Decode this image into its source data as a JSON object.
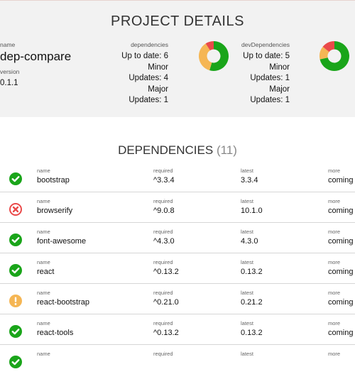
{
  "project_details": {
    "title": "PROJECT DETAILS",
    "name_label": "name",
    "name": "dep-compare",
    "version_label": "version",
    "version": "0.1.1",
    "dependencies": {
      "label": "dependencies",
      "lines": [
        "Up to date: 6",
        "Minor",
        "Updates: 4",
        "Major",
        "Updates: 1"
      ],
      "up_to_date": 6,
      "minor_updates": 4,
      "major_updates": 1
    },
    "devDependencies": {
      "label": "devDependencies",
      "lines": [
        "Up to date: 5",
        "Minor",
        "Updates: 1",
        "Major",
        "Updates: 1"
      ],
      "up_to_date": 5,
      "minor_updates": 1,
      "major_updates": 1
    }
  },
  "colors": {
    "up_to_date": "#1aa51a",
    "minor": "#f5b654",
    "major": "#ea4a4a",
    "details_bg": "#f2f2f2",
    "separator": "#d6d6d6"
  },
  "dependencies": {
    "title": "DEPENDENCIES",
    "count": "(11)",
    "columns": {
      "name": "name",
      "required": "required",
      "latest": "latest",
      "more": "more"
    },
    "rows": [
      {
        "status": "ok",
        "status_icon": "check-circle-icon",
        "name": "bootstrap",
        "required": "^3.3.4",
        "latest": "3.3.4",
        "more": "coming"
      },
      {
        "status": "major",
        "status_icon": "x-circle-icon",
        "name": "browserify",
        "required": "^9.0.8",
        "latest": "10.1.0",
        "more": "coming"
      },
      {
        "status": "ok",
        "status_icon": "check-circle-icon",
        "name": "font-awesome",
        "required": "^4.3.0",
        "latest": "4.3.0",
        "more": "coming"
      },
      {
        "status": "ok",
        "status_icon": "check-circle-icon",
        "name": "react",
        "required": "^0.13.2",
        "latest": "0.13.2",
        "more": "coming"
      },
      {
        "status": "minor",
        "status_icon": "exclamation-circle-icon",
        "name": "react-bootstrap",
        "required": "^0.21.0",
        "latest": "0.21.2",
        "more": "coming"
      },
      {
        "status": "ok",
        "status_icon": "check-circle-icon",
        "name": "react-tools",
        "required": "^0.13.2",
        "latest": "0.13.2",
        "more": "coming"
      },
      {
        "status": "ok",
        "status_icon": "check-circle-icon",
        "name": "",
        "required": "",
        "latest": "",
        "more": ""
      }
    ]
  }
}
